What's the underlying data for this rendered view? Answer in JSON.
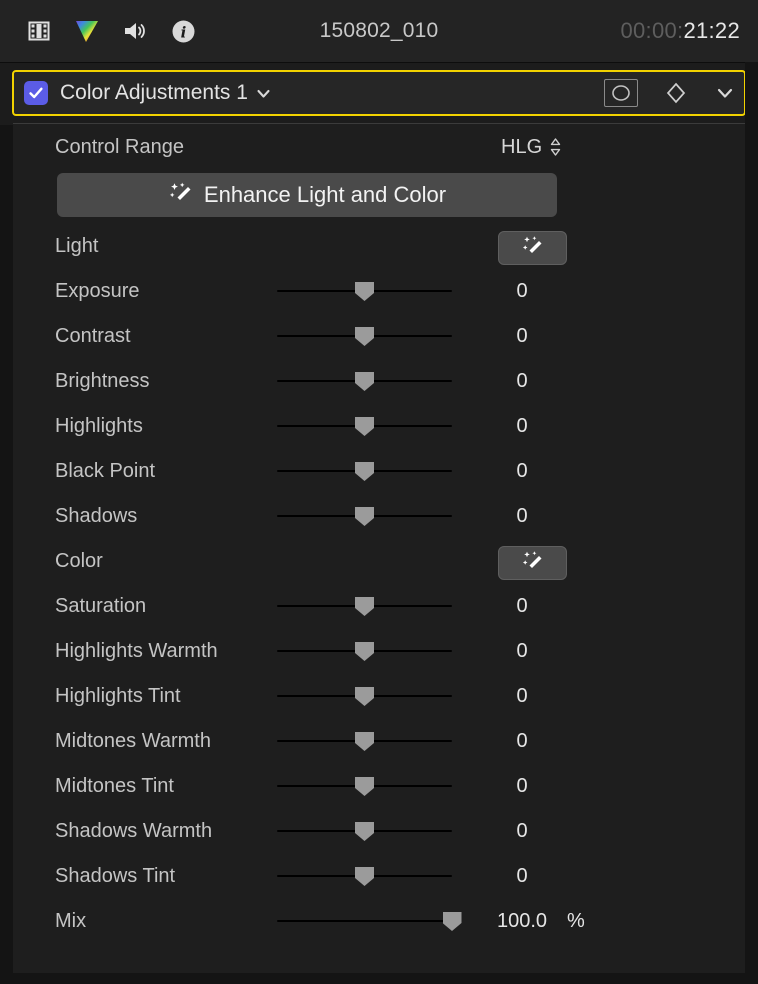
{
  "toolbar": {
    "icons": [
      {
        "name": "film-strip-icon",
        "label": "Video"
      },
      {
        "name": "color-triangle-icon",
        "label": "Color"
      },
      {
        "name": "speaker-icon",
        "label": "Audio"
      },
      {
        "name": "info-icon",
        "label": "Info"
      }
    ],
    "clip_title": "150802_010",
    "timecode_dim": "00:00:",
    "timecode_bright": "21:22"
  },
  "effect_header": {
    "checkbox_checked": true,
    "name": "Color Adjustments 1",
    "name_caret": "chevron-down-icon",
    "mask_icon": "shape-mask-icon",
    "keyframe_icon": "keyframe-diamond-icon",
    "collapse_icon": "chevron-down-icon",
    "highlight_color": "#f2d200",
    "checkbox_color": "#5b5ce6"
  },
  "control_range": {
    "label": "Control Range",
    "value": "HLG"
  },
  "enhance": {
    "label": "Enhance Light and Color",
    "icon": "magic-wand-icon"
  },
  "sections": [
    {
      "title": "Light",
      "wand_icon": "magic-wand-icon",
      "rows": [
        {
          "label": "Exposure",
          "value": "0",
          "unit": "",
          "thumb_pct": 50
        },
        {
          "label": "Contrast",
          "value": "0",
          "unit": "",
          "thumb_pct": 50
        },
        {
          "label": "Brightness",
          "value": "0",
          "unit": "",
          "thumb_pct": 50
        },
        {
          "label": "Highlights",
          "value": "0",
          "unit": "",
          "thumb_pct": 50
        },
        {
          "label": "Black Point",
          "value": "0",
          "unit": "",
          "thumb_pct": 50
        },
        {
          "label": "Shadows",
          "value": "0",
          "unit": "",
          "thumb_pct": 50
        }
      ]
    },
    {
      "title": "Color",
      "wand_icon": "magic-wand-icon",
      "rows": [
        {
          "label": "Saturation",
          "value": "0",
          "unit": "",
          "thumb_pct": 50
        },
        {
          "label": "Highlights Warmth",
          "value": "0",
          "unit": "",
          "thumb_pct": 50
        },
        {
          "label": "Highlights Tint",
          "value": "0",
          "unit": "",
          "thumb_pct": 50
        },
        {
          "label": "Midtones Warmth",
          "value": "0",
          "unit": "",
          "thumb_pct": 50
        },
        {
          "label": "Midtones Tint",
          "value": "0",
          "unit": "",
          "thumb_pct": 50
        },
        {
          "label": "Shadows Warmth",
          "value": "0",
          "unit": "",
          "thumb_pct": 50
        },
        {
          "label": "Shadows Tint",
          "value": "0",
          "unit": "",
          "thumb_pct": 50
        }
      ]
    }
  ],
  "mix": {
    "label": "Mix",
    "value": "100.0",
    "unit": "%",
    "thumb_pct": 100
  }
}
